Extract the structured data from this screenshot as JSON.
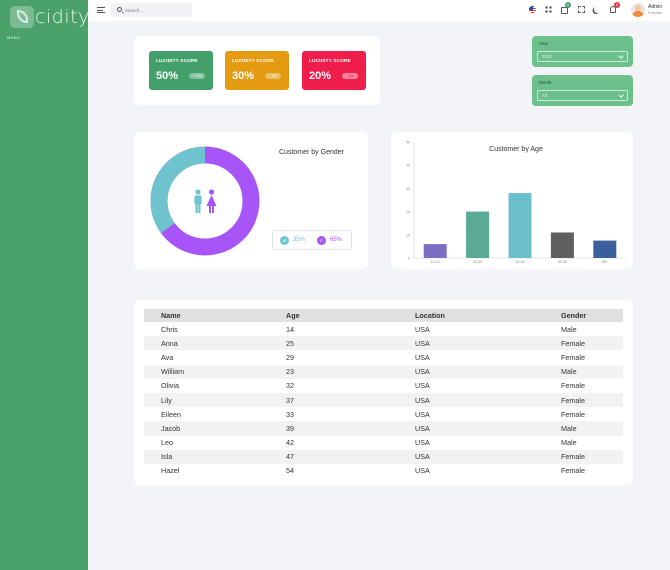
{
  "app": {
    "logo_text": "cidity",
    "menu_label": "MENU"
  },
  "header": {
    "search_placeholder": "Search...",
    "cart_badge": "6",
    "notifications_badge": "6",
    "user_name": "Admin",
    "user_role": "Founder",
    "icons": [
      "menu-icon",
      "search-icon",
      "us-flag-icon",
      "apps-grid-icon",
      "shopping-bag-icon",
      "fullscreen-icon",
      "moon-icon",
      "bell-icon"
    ]
  },
  "scores": [
    {
      "label": "LUCIDITY SCORE",
      "value": "50%",
      "pill": "+ 10%",
      "color": "#43a06a"
    },
    {
      "label": "LUCIDITY SCORE",
      "value": "30%",
      "pill": "+ 5%",
      "color": "#e49b12"
    },
    {
      "label": "LUCIDITY SCORE",
      "value": "20%",
      "pill": "- 5%",
      "color": "#ee1d4a"
    }
  ],
  "filters": {
    "year": {
      "label": "Year",
      "value": "2023"
    },
    "month": {
      "label": "Month",
      "value": "All"
    }
  },
  "gender_chart": {
    "title": "Customer by Gender",
    "male_letter": "M",
    "male_value": "35%",
    "female_letter": "F",
    "female_value": "65%",
    "male_color": "#6ec3cf",
    "female_color": "#a855f7"
  },
  "chart_data": {
    "type": "bar",
    "title": "Customer by Age",
    "categories": [
      "10-20",
      "20-30",
      "30-40",
      "40-50",
      "50+"
    ],
    "values": [
      6,
      20,
      28,
      11,
      7.5
    ],
    "colors": [
      "#7b6fc4",
      "#5aaa96",
      "#6cc0cc",
      "#5f5f5f",
      "#3a5f9a"
    ],
    "yticks": [
      "0",
      "10",
      "20",
      "30",
      "40",
      "50"
    ],
    "ylim": [
      0,
      50
    ],
    "xlabel": "",
    "ylabel": "",
    "grid": false
  },
  "table": {
    "headers": [
      "Name",
      "Age",
      "Location",
      "Gender"
    ],
    "rows": [
      [
        "Chris",
        "14",
        "USA",
        "Male"
      ],
      [
        "Anna",
        "25",
        "USA",
        "Female"
      ],
      [
        "Ava",
        "29",
        "USA",
        "Female"
      ],
      [
        "William",
        "23",
        "USA",
        "Male"
      ],
      [
        "Olivia",
        "32",
        "USA",
        "Female"
      ],
      [
        "Lily",
        "37",
        "USA",
        "Female"
      ],
      [
        "Eileen",
        "33",
        "USA",
        "Female"
      ],
      [
        "Jacob",
        "39",
        "USA",
        "Male"
      ],
      [
        "Leo",
        "42",
        "USA",
        "Male"
      ],
      [
        "Isla",
        "47",
        "USA",
        "Female"
      ],
      [
        "Hazel",
        "54",
        "USA",
        "Female"
      ]
    ]
  }
}
